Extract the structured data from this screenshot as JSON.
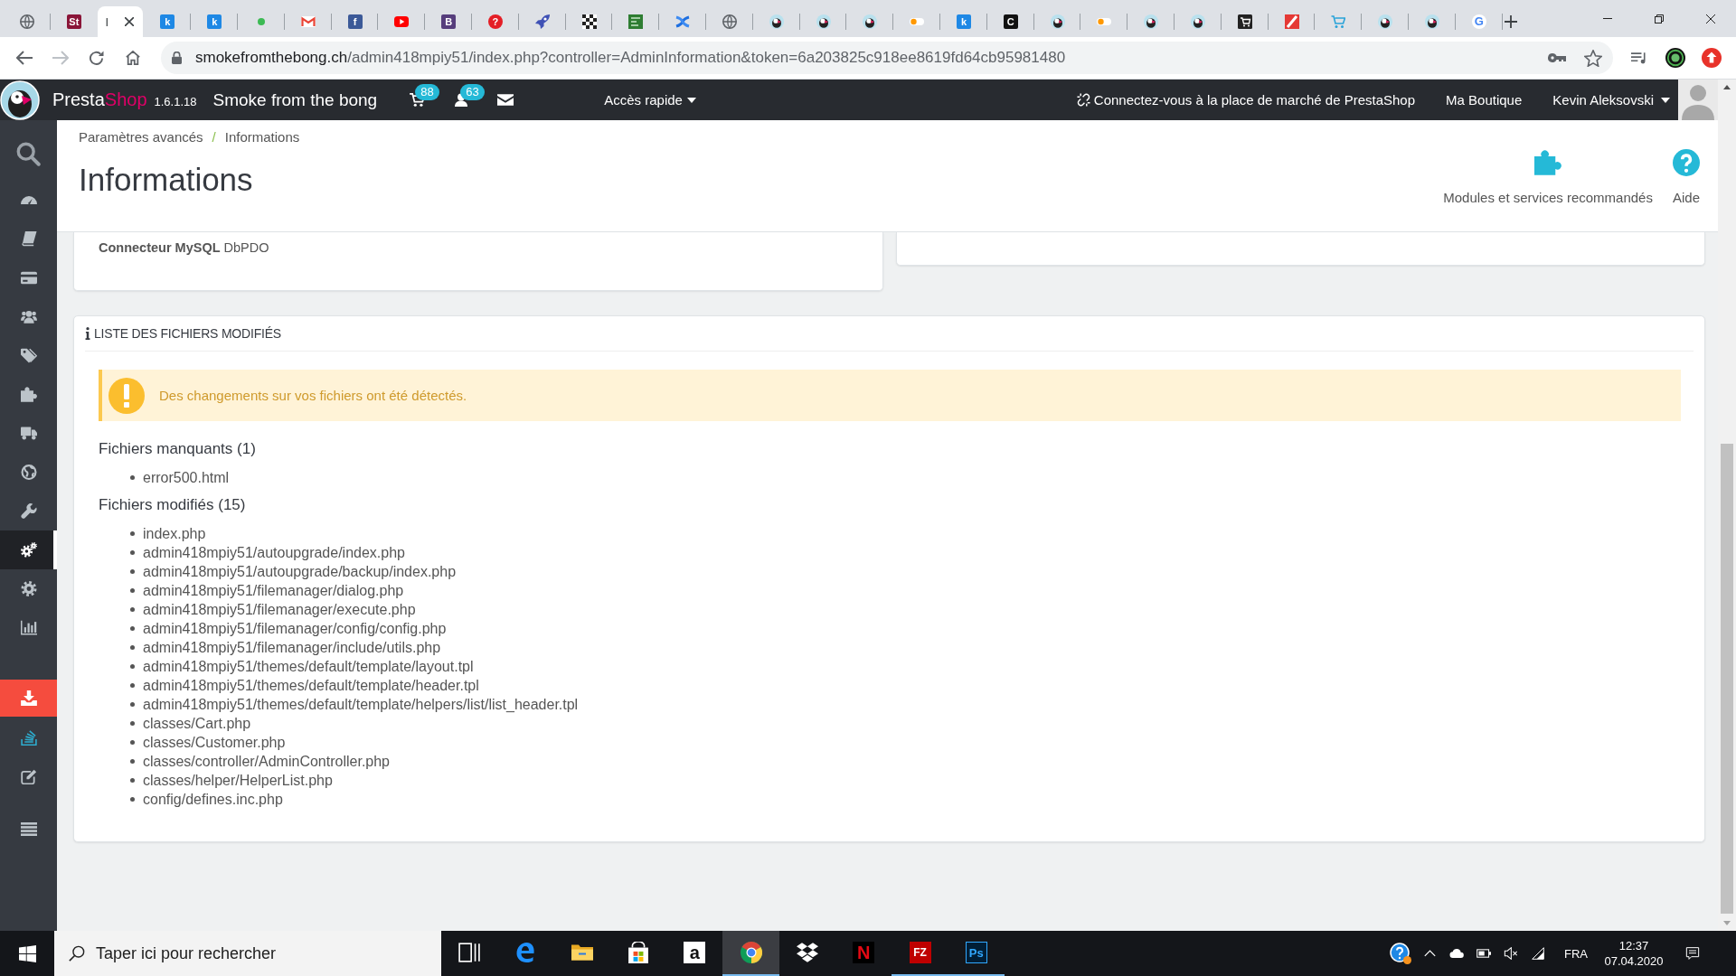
{
  "browser": {
    "tabs": [
      {
        "kind": "globe",
        "selected": false
      },
      {
        "kind": "letter",
        "glyph": "St",
        "color": "#8a1538",
        "selected": false
      },
      {
        "kind": "page",
        "title": "I",
        "selected": true
      },
      {
        "kind": "letter",
        "glyph": "k",
        "color": "#1e88e5",
        "selected": false
      },
      {
        "kind": "letter",
        "glyph": "k",
        "color": "#1e88e5",
        "selected": false
      },
      {
        "kind": "dot",
        "color": "#3cba54",
        "selected": false
      },
      {
        "kind": "mail",
        "selected": false
      },
      {
        "kind": "letter",
        "glyph": "f",
        "color": "#3b5998",
        "selected": false
      },
      {
        "kind": "video",
        "selected": false
      },
      {
        "kind": "letter",
        "glyph": "B",
        "color": "#563d7c",
        "selected": false
      },
      {
        "kind": "pin",
        "glyph": "?",
        "color": "#e41e26",
        "selected": false
      },
      {
        "kind": "rocket",
        "selected": false
      },
      {
        "kind": "grid",
        "selected": false
      },
      {
        "kind": "square",
        "selected": false
      },
      {
        "kind": "cross",
        "selected": false
      },
      {
        "kind": "globe",
        "selected": false
      },
      {
        "kind": "puffin",
        "selected": false
      },
      {
        "kind": "puffin",
        "selected": false
      },
      {
        "kind": "puffin",
        "selected": false
      },
      {
        "kind": "toggle",
        "selected": false
      },
      {
        "kind": "letter",
        "glyph": "k",
        "color": "#1e88e5",
        "selected": false
      },
      {
        "kind": "letter",
        "glyph": "C",
        "color": "#111111",
        "selected": false
      },
      {
        "kind": "puffin",
        "selected": false
      },
      {
        "kind": "toggle",
        "selected": false
      },
      {
        "kind": "puffin",
        "selected": false
      },
      {
        "kind": "puffin",
        "selected": false
      },
      {
        "kind": "cart-tile",
        "selected": false
      },
      {
        "kind": "slash",
        "selected": false
      },
      {
        "kind": "cart",
        "selected": false
      },
      {
        "kind": "puffin",
        "selected": false
      },
      {
        "kind": "puffin",
        "selected": false
      },
      {
        "kind": "google",
        "glyph": "G",
        "selected": false
      }
    ]
  },
  "address_bar": {
    "forward_disabled": true,
    "host": "smokefromthebong.ch",
    "path": "/admin418mpiy51/index.php?controller=AdminInformation&token=6a203825c918ee8619fd64cb95981480"
  },
  "admin": {
    "header": {
      "brand": {
        "main": "Presta",
        "accent": "Shop"
      },
      "version": "1.6.1.18",
      "shop_name": "Smoke from the bong",
      "notifications": [
        {
          "kind": "cart",
          "count": "88"
        },
        {
          "kind": "customer",
          "count": "63"
        },
        {
          "kind": "message"
        }
      ],
      "quick_access": "Accès rapide",
      "marketplace": "Connectez-vous à la place de marché de PrestaShop",
      "shop_link": "Ma Boutique",
      "employee": "Kevin Aleksovski"
    },
    "sidebar": {
      "items": [
        {
          "kind": "search",
          "selected": false
        },
        {
          "kind": "dashboard",
          "selected": false
        },
        {
          "kind": "book",
          "selected": false
        },
        {
          "kind": "card",
          "selected": false
        },
        {
          "kind": "users",
          "selected": false
        },
        {
          "kind": "tags",
          "selected": false
        },
        {
          "kind": "puzzle",
          "selected": false
        },
        {
          "kind": "truck",
          "selected": false
        },
        {
          "kind": "globe",
          "selected": false
        },
        {
          "kind": "wrench",
          "selected": false
        },
        {
          "kind": "gears",
          "selected": true
        },
        {
          "kind": "gear",
          "selected": false
        },
        {
          "kind": "chart",
          "selected": false
        }
      ],
      "tools": [
        {
          "kind": "download"
        },
        {
          "kind": "stack"
        },
        {
          "kind": "edit"
        },
        {
          "kind": "list"
        }
      ]
    }
  },
  "page_header": {
    "breadcrumb": [
      "Paramètres avancés",
      "Informations"
    ],
    "breadcrumb_separator": "/",
    "title": "Informations",
    "toolbar": [
      {
        "kind": "puzzle",
        "label": "Modules et services recommandés"
      },
      {
        "kind": "help",
        "label": "Aide"
      }
    ]
  },
  "config_panel": {
    "rows": [
      "**Connecteur MySQL** DbPDO"
    ]
  },
  "files_panel": {
    "title": "LISTE DES FICHIERS MODIFIÉS",
    "alert": "Des changements sur vos fichiers ont été détectés.",
    "groups": [
      {
        "heading": "Fichiers manquants (1)",
        "files": [
          "error500.html"
        ]
      },
      {
        "heading": "Fichiers modifiés (15)",
        "files": [
          "index.php",
          "admin418mpiy51/autoupgrade/index.php",
          "admin418mpiy51/autoupgrade/backup/index.php",
          "admin418mpiy51/filemanager/dialog.php",
          "admin418mpiy51/filemanager/execute.php",
          "admin418mpiy51/filemanager/config/config.php",
          "admin418mpiy51/filemanager/include/utils.php",
          "admin418mpiy51/themes/default/template/layout.tpl",
          "admin418mpiy51/themes/default/template/header.tpl",
          "admin418mpiy51/themes/default/template/helpers/list/list_header.tpl",
          "classes/Cart.php",
          "classes/Customer.php",
          "classes/controller/AdminController.php",
          "classes/helper/HelperList.php",
          "config/defines.inc.php"
        ]
      }
    ]
  },
  "taskbar": {
    "search": {
      "placeholder": "Taper ici pour rechercher"
    },
    "apps": [
      {
        "kind": "task-view",
        "running": false,
        "selected": false
      },
      {
        "kind": "edge",
        "running": false,
        "selected": false
      },
      {
        "kind": "explorer",
        "running": false,
        "selected": false
      },
      {
        "kind": "store",
        "running": false,
        "selected": false
      },
      {
        "kind": "amazon",
        "glyph": "a",
        "running": false,
        "selected": false
      },
      {
        "kind": "chrome",
        "running": true,
        "selected": true
      },
      {
        "kind": "dropbox",
        "running": false,
        "selected": false
      },
      {
        "kind": "netflix",
        "glyph": "N",
        "running": false,
        "selected": false
      },
      {
        "kind": "filezilla",
        "glyph": "FZ",
        "running": true,
        "selected": false
      },
      {
        "kind": "photoshop",
        "glyph": "Ps",
        "running": true,
        "selected": false
      }
    ],
    "tray": {
      "language": "FRA",
      "time": "12:37",
      "date": "07.04.2020"
    }
  }
}
